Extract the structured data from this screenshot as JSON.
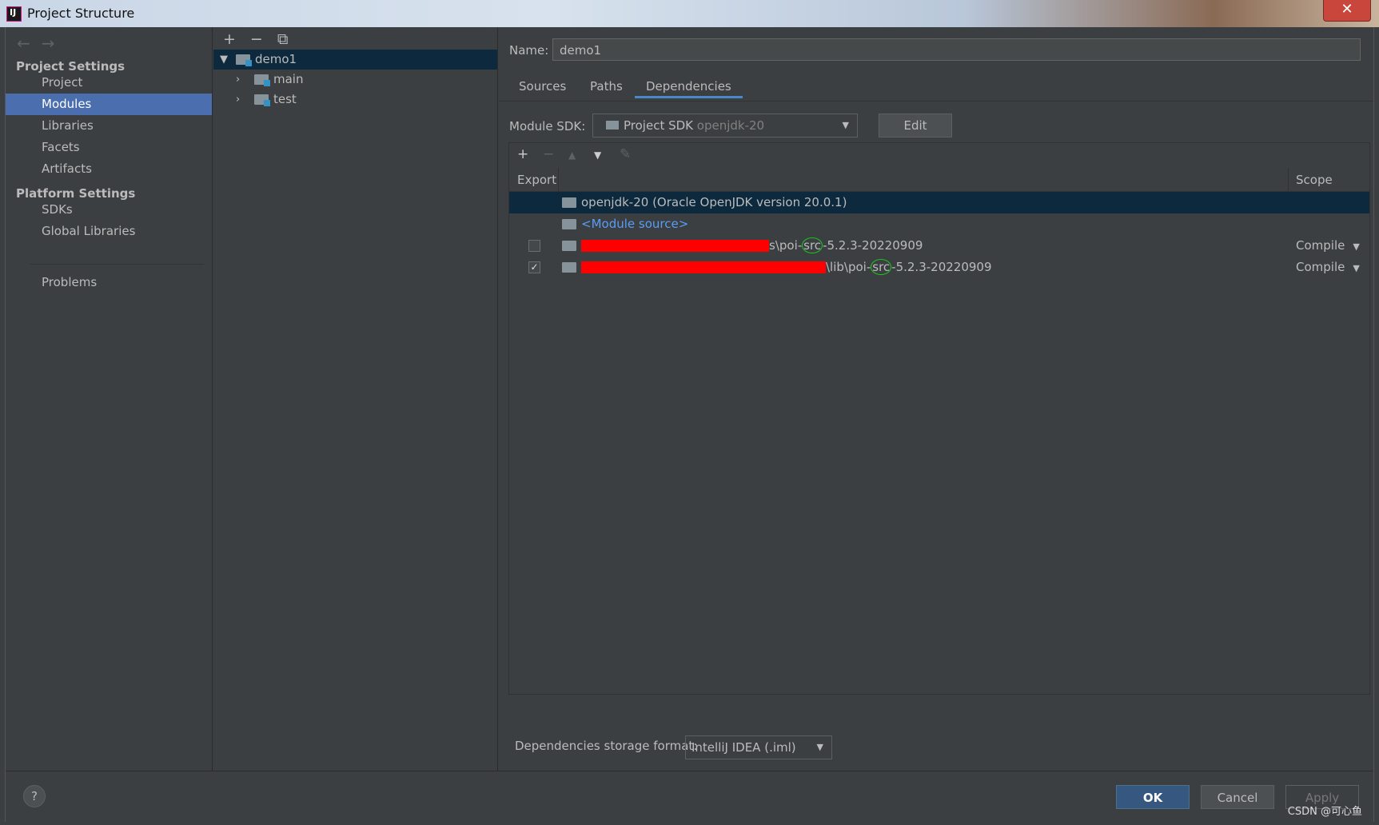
{
  "window": {
    "title": "Project Structure",
    "close_glyph": "✕"
  },
  "sidebar": {
    "nav": {
      "back_icon": "back-arrow-icon",
      "forward_icon": "forward-arrow-icon"
    },
    "project_settings_title": "Project Settings",
    "project_items": [
      {
        "label": "Project",
        "selected": false
      },
      {
        "label": "Modules",
        "selected": true
      },
      {
        "label": "Libraries",
        "selected": false
      },
      {
        "label": "Facets",
        "selected": false
      },
      {
        "label": "Artifacts",
        "selected": false
      }
    ],
    "platform_settings_title": "Platform Settings",
    "platform_items": [
      {
        "label": "SDKs"
      },
      {
        "label": "Global Libraries"
      }
    ],
    "problems_label": "Problems"
  },
  "tree": {
    "toolbar": {
      "add": "+",
      "remove": "−",
      "copy_icon": "copy-icon"
    },
    "nodes": [
      {
        "label": "demo1",
        "expanded": true,
        "level": 0
      },
      {
        "label": "main",
        "expanded": false,
        "level": 1
      },
      {
        "label": "test",
        "expanded": false,
        "level": 1
      }
    ]
  },
  "main": {
    "name_label": "Name:",
    "name_value": "demo1",
    "tabs": [
      {
        "label": "Sources",
        "selected": false
      },
      {
        "label": "Paths",
        "selected": false
      },
      {
        "label": "Dependencies",
        "selected": true
      }
    ],
    "module_sdk_label": "Module SDK:",
    "module_sdk_value": "Project SDK",
    "module_sdk_detail": "openjdk-20",
    "edit_label": "Edit",
    "deps_toolbar": {
      "add": "+",
      "remove": "−",
      "up": "▲",
      "down": "▼",
      "edit_icon": "pencil-icon"
    },
    "deps_headers": {
      "export": "Export",
      "scope": "Scope"
    },
    "deps": [
      {
        "text": "openjdk-20 (Oracle OpenJDK version 20.0.1)",
        "selected": true
      },
      {
        "text": "<Module source>",
        "link": true
      },
      {
        "checked": false,
        "suffix_before": "s\\poi-",
        "highlight": "src",
        "suffix_after": "-5.2.3-20220909",
        "scope": "Compile"
      },
      {
        "checked": true,
        "suffix_before": "\\lib\\poi-",
        "highlight": "src",
        "suffix_after": "-5.2.3-20220909",
        "scope": "Compile"
      }
    ],
    "storage_label": "Dependencies storage format:",
    "storage_value": "IntelliJ IDEA (.iml)"
  },
  "footer": {
    "help": "?",
    "ok": "OK",
    "cancel": "Cancel",
    "apply": "Apply",
    "watermark": "CSDN @可心鱼"
  },
  "colors": {
    "selection": "#4b6eaf",
    "tree_selection": "#0d293e",
    "link": "#589df6",
    "redaction": "#ff0000",
    "annotation_circle": "#18c918",
    "ok_button": "#365880"
  }
}
